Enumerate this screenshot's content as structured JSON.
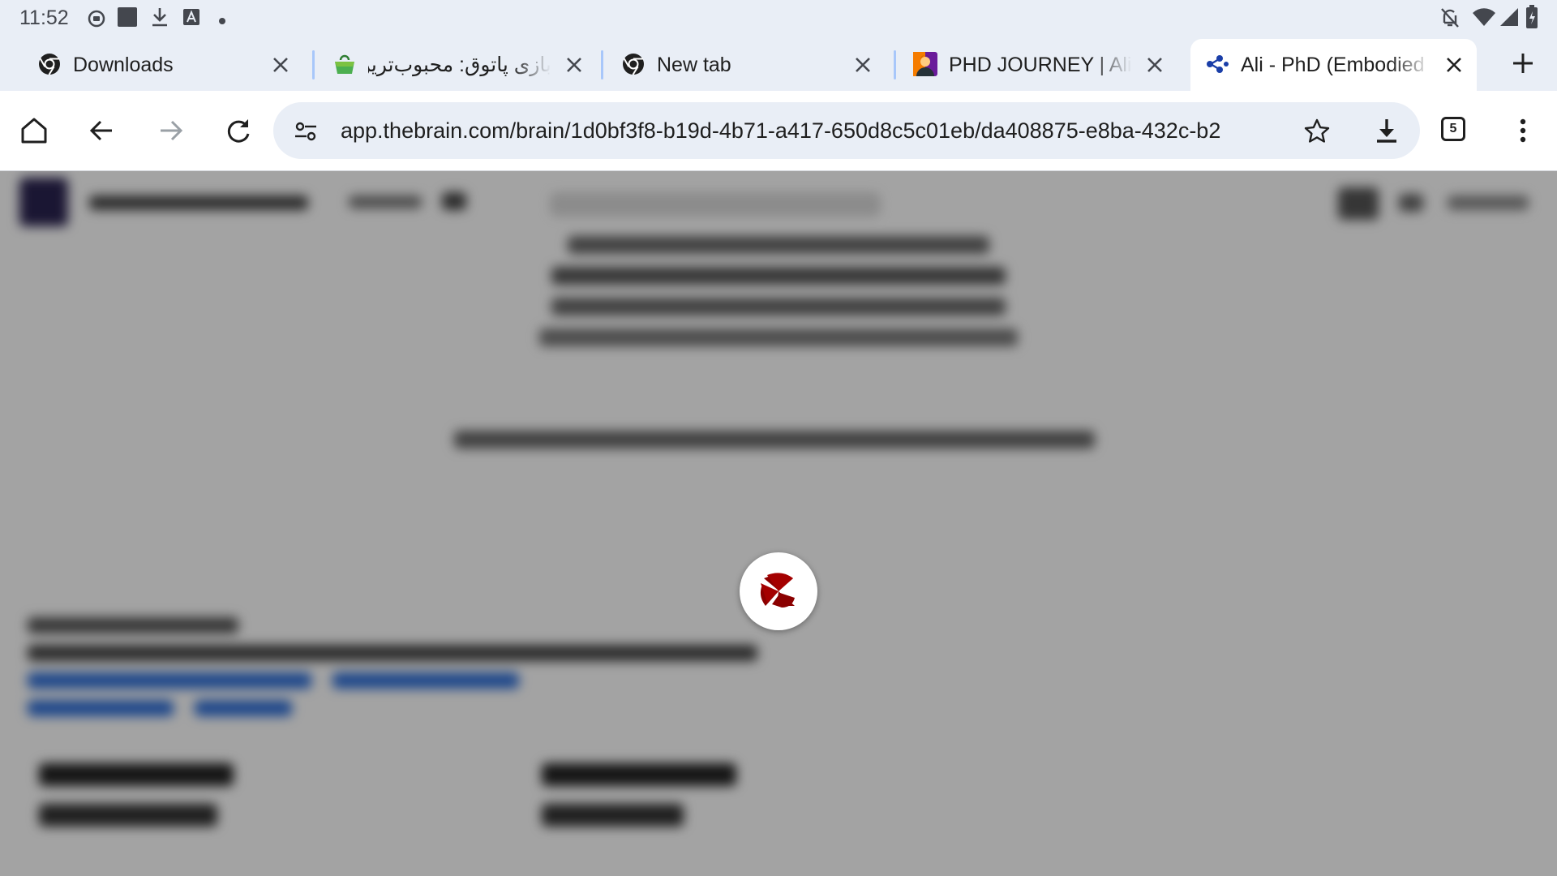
{
  "status_bar": {
    "time": "11:52",
    "left_icons": [
      "record-icon",
      "square-icon",
      "download-icon",
      "font-icon",
      "dot-icon"
    ],
    "right_icons": [
      "bell-off-icon",
      "wifi-icon",
      "signal-icon",
      "battery-icon"
    ]
  },
  "tabs": [
    {
      "title": "Downloads",
      "icon": "chrome-icon",
      "active": false
    },
    {
      "title": "بازی پاتوق: محبوب‌ترین شبکه",
      "icon": "bag-icon",
      "active": false
    },
    {
      "title": "New tab",
      "icon": "chrome-icon",
      "active": false
    },
    {
      "title": "PHD JOURNEY | Ali Taheri",
      "icon": "avatar-icon",
      "active": false
    },
    {
      "title": "Ali - PhD (Embodied XR)",
      "icon": "thebrain-icon",
      "active": true
    }
  ],
  "toolbar": {
    "url": "app.thebrain.com/brain/1d0bf3f8-b19d-4b71-a417-650d8c5c01eb/da408875-e8ba-432c-b2",
    "tab_count": "5"
  },
  "content": {
    "state": "loading",
    "spinner_icon": "thebrain-loading-icon"
  },
  "colors": {
    "chrome_bg": "#e9eef6",
    "tab_separator": "#a8c7fa",
    "spinner_mark": "#8b0000"
  }
}
